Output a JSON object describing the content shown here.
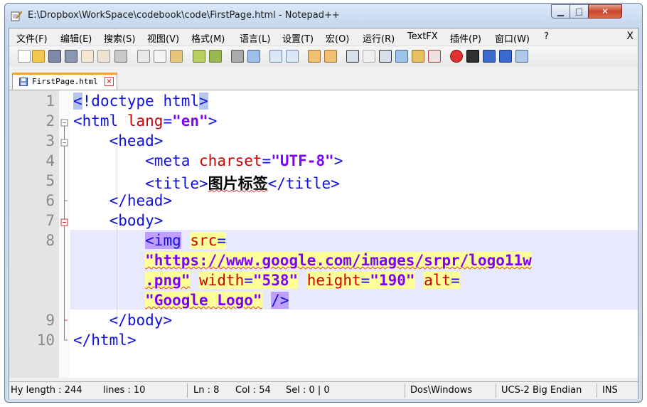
{
  "window": {
    "title": "E:\\Dropbox\\WorkSpace\\codebook\\code\\FirstPage.html - Notepad++",
    "minimize_glyph": "▁",
    "maximize_glyph": "□",
    "close_glyph": "✕"
  },
  "menu": {
    "items": [
      "文件(F)",
      "编辑(E)",
      "搜索(S)",
      "视图(V)",
      "格式(M)",
      "语言(L)",
      "设置(T)",
      "宏(O)",
      "运行(R)",
      "TextFX",
      "插件(P)",
      "窗口(W)",
      "?"
    ],
    "close_glyph": "X"
  },
  "tab": {
    "label": "FirstPage.html",
    "close_glyph": "×"
  },
  "editor": {
    "line_numbers": [
      "1",
      "2",
      "3",
      "4",
      "5",
      "6",
      "7",
      "8",
      "",
      "",
      "",
      "9",
      "10"
    ],
    "line1": {
      "lt": "<",
      "rest": "!doctype html",
      "gt": ">"
    },
    "line2": {
      "open": "<html",
      "attr": "lang",
      "eq": "=",
      "val": "\"en\"",
      "close": ">"
    },
    "line3": {
      "text": "<head>"
    },
    "line4": {
      "open": "<meta",
      "attr": "charset",
      "eq": "=",
      "val": "\"UTF-8\"",
      "close": ">"
    },
    "line5": {
      "open": "<title>",
      "text": "图片标签",
      "close": "</title>"
    },
    "line6": {
      "text": "</head>"
    },
    "line7": {
      "text": "<body>"
    },
    "line8": {
      "open": "<img",
      "src_attr": "src",
      "eq": "=",
      "src_val": "\"https://www.google.com/images/srpr/logo11w",
      "src_val_end": ".png\"",
      "width_attr": "width",
      "width_val": "\"538\"",
      "height_attr": "height",
      "height_val": "\"190\"",
      "alt_attr": "alt",
      "alt_val": "\"Google Logo\"",
      "self_close": "/>"
    },
    "line9": {
      "text": "</body>"
    },
    "line10": {
      "text": "</html>"
    }
  },
  "status": {
    "length": "Hy length : 244",
    "lines": "lines : 10",
    "ln": "Ln : 8",
    "col": "Col : 54",
    "sel": "Sel : 0 | 0",
    "eol": "Dos\\Windows",
    "encoding": "UCS-2 Big Endian",
    "mode": "INS"
  },
  "colors": {
    "tag": "#1010e0",
    "attribute": "#cc0000",
    "value": "#8000ff",
    "current_line": "#e8e8ff",
    "tab_accent": "#f7a425"
  }
}
